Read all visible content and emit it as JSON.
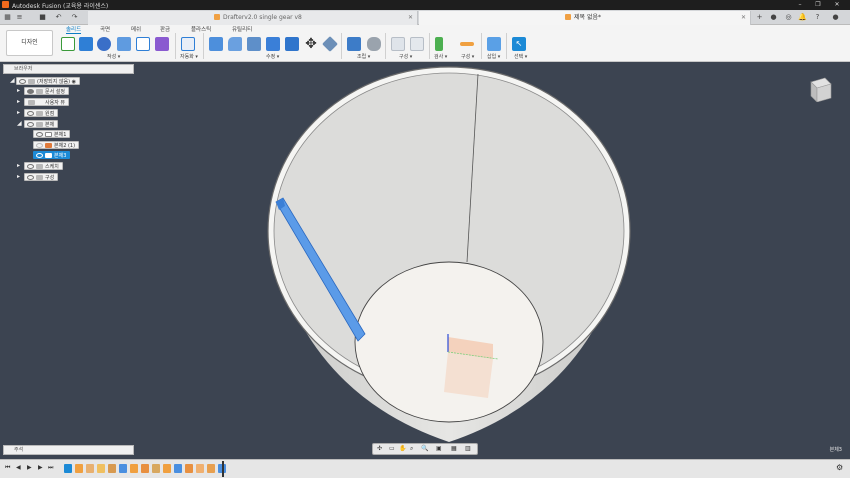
{
  "titlebar": {
    "title": "Autodesk Fusion (교육용 라이센스)"
  },
  "tabs": [
    {
      "label": "Drafterv2.0 single gear v8"
    },
    {
      "label": "제목 없음*"
    }
  ],
  "ribbon": {
    "workspace": "디자인",
    "tabs": [
      "솔리드",
      "곡면",
      "메쉬",
      "판금",
      "플라스틱",
      "유틸리티"
    ],
    "groups": {
      "create": "작성 ▾",
      "automate": "자동화 ▾",
      "modify": "수정 ▾",
      "assemble": "조립 ▾",
      "construct": "구성 ▾",
      "inspect": "검사 ▾",
      "insert": "삽입 ▾",
      "select": "선택 ▾",
      "configure": "구성 ▾"
    }
  },
  "browser": {
    "title": "브라우저",
    "root": "(저장되지 않음)",
    "nodes": {
      "doc_settings": "문서 설정",
      "named_views": "사용자 뷰",
      "origin": "원점",
      "bodies": "본체",
      "body1": "본체1",
      "body2": "본체2 (1)",
      "body3": "본체3",
      "sketches": "스케치",
      "construction": "구성"
    }
  },
  "comments": {
    "title": "주석"
  },
  "status_right": "본체3",
  "colors": {
    "accent": "#1c8ad6",
    "viewport_bg": "#3c4451",
    "selected_body": "#4a8fe0"
  }
}
